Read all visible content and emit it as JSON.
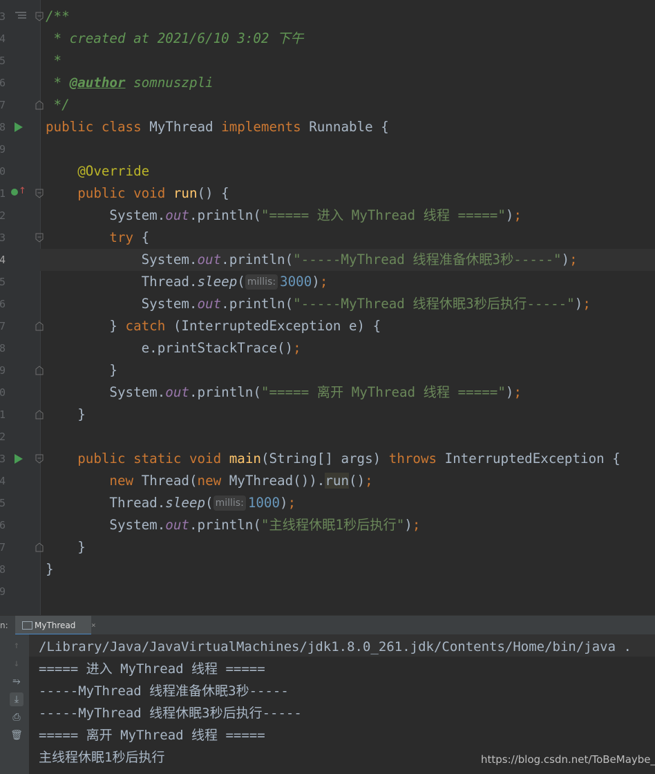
{
  "editor": {
    "line_numbers": [
      "3",
      "4",
      "5",
      "6",
      "7",
      "8",
      "9",
      "0",
      "1",
      "2",
      "3",
      "4",
      "5",
      "6",
      "7",
      "8",
      "9",
      "0",
      "1",
      "2",
      "3",
      "4",
      "5",
      "6",
      "7",
      "8",
      "9"
    ],
    "lines": [
      [
        {
          "t": "/**",
          "c": "cm"
        }
      ],
      [
        {
          "t": " * created at 2021/6/10 3:02 下午",
          "c": "cm"
        }
      ],
      [
        {
          "t": " *",
          "c": "cm"
        }
      ],
      [
        {
          "t": " * ",
          "c": "cm"
        },
        {
          "t": "@author",
          "c": "tag"
        },
        {
          "t": " somnuszpli",
          "c": "cm"
        }
      ],
      [
        {
          "t": " */",
          "c": "cm"
        }
      ],
      [
        {
          "t": "public class ",
          "c": "kw"
        },
        {
          "t": "MyThread "
        },
        {
          "t": "implements ",
          "c": "kw"
        },
        {
          "t": "Runnable {"
        }
      ],
      [],
      [
        {
          "t": "    "
        },
        {
          "t": "@Override",
          "c": "ann"
        }
      ],
      [
        {
          "t": "    "
        },
        {
          "t": "public void ",
          "c": "kw"
        },
        {
          "t": "run",
          "c": "fn"
        },
        {
          "t": "() {"
        }
      ],
      [
        {
          "t": "        System."
        },
        {
          "t": "out",
          "c": "fld"
        },
        {
          "t": ".println("
        },
        {
          "t": "\"===== 进入 MyThread 线程 =====\"",
          "c": "str"
        },
        {
          "t": ")"
        },
        {
          "t": ";",
          "c": "kw"
        }
      ],
      [
        {
          "t": "        "
        },
        {
          "t": "try ",
          "c": "kw"
        },
        {
          "t": "{"
        }
      ],
      [
        {
          "t": "            System."
        },
        {
          "t": "out",
          "c": "fld"
        },
        {
          "t": ".println("
        },
        {
          "t": "\"-----MyThread 线程准备休眠3秒-----\"",
          "c": "str"
        },
        {
          "t": ")"
        },
        {
          "t": ";",
          "c": "kw"
        }
      ],
      [
        {
          "t": "            Thread."
        },
        {
          "t": "sleep",
          "c": "st"
        },
        {
          "t": "("
        },
        {
          "t": "millis:",
          "c": "hint"
        },
        {
          "t": "3000",
          "c": "num"
        },
        {
          "t": ")"
        },
        {
          "t": ";",
          "c": "kw"
        }
      ],
      [
        {
          "t": "            System."
        },
        {
          "t": "out",
          "c": "fld"
        },
        {
          "t": ".println("
        },
        {
          "t": "\"-----MyThread 线程休眠3秒后执行-----\"",
          "c": "str"
        },
        {
          "t": ")"
        },
        {
          "t": ";",
          "c": "kw"
        }
      ],
      [
        {
          "t": "        } "
        },
        {
          "t": "catch ",
          "c": "kw"
        },
        {
          "t": "(InterruptedException e) {"
        }
      ],
      [
        {
          "t": "            e.printStackTrace()"
        },
        {
          "t": ";",
          "c": "kw"
        }
      ],
      [
        {
          "t": "        }"
        }
      ],
      [
        {
          "t": "        System."
        },
        {
          "t": "out",
          "c": "fld"
        },
        {
          "t": ".println("
        },
        {
          "t": "\"===== 离开 MyThread 线程 =====\"",
          "c": "str"
        },
        {
          "t": ")"
        },
        {
          "t": ";",
          "c": "kw"
        }
      ],
      [
        {
          "t": "    }"
        }
      ],
      [],
      [
        {
          "t": "    "
        },
        {
          "t": "public static void ",
          "c": "kw"
        },
        {
          "t": "main",
          "c": "fn"
        },
        {
          "t": "(String[] args) "
        },
        {
          "t": "throws ",
          "c": "kw"
        },
        {
          "t": "InterruptedException {"
        }
      ],
      [
        {
          "t": "        "
        },
        {
          "t": "new ",
          "c": "kw"
        },
        {
          "t": "Thread("
        },
        {
          "t": "new ",
          "c": "kw"
        },
        {
          "t": "MyThread())."
        },
        {
          "t": "run",
          "c": "hl"
        },
        {
          "t": "()"
        },
        {
          "t": ";",
          "c": "kw"
        }
      ],
      [
        {
          "t": "        Thread."
        },
        {
          "t": "sleep",
          "c": "st"
        },
        {
          "t": "("
        },
        {
          "t": "millis:",
          "c": "hint"
        },
        {
          "t": "1000",
          "c": "num"
        },
        {
          "t": ")"
        },
        {
          "t": ";",
          "c": "kw"
        }
      ],
      [
        {
          "t": "        System."
        },
        {
          "t": "out",
          "c": "fld"
        },
        {
          "t": ".println("
        },
        {
          "t": "\"主线程休眠1秒后执行\"",
          "c": "str"
        },
        {
          "t": ")"
        },
        {
          "t": ";",
          "c": "kw"
        }
      ],
      [
        {
          "t": "    }"
        }
      ],
      [
        {
          "t": "}"
        }
      ],
      []
    ]
  },
  "run_panel": {
    "label": "n:",
    "tab_label": "MyThread",
    "tab_close": "×"
  },
  "console": {
    "lines": [
      "/Library/Java/JavaVirtualMachines/jdk1.8.0_261.jdk/Contents/Home/bin/java .",
      "===== 进入 MyThread 线程 =====",
      "-----MyThread 线程准备休眠3秒-----",
      "-----MyThread 线程休眠3秒后执行-----",
      "===== 离开 MyThread 线程 =====",
      "主线程休眠1秒后执行"
    ]
  },
  "watermark": "https://blog.csdn.net/ToBeMaybe_"
}
